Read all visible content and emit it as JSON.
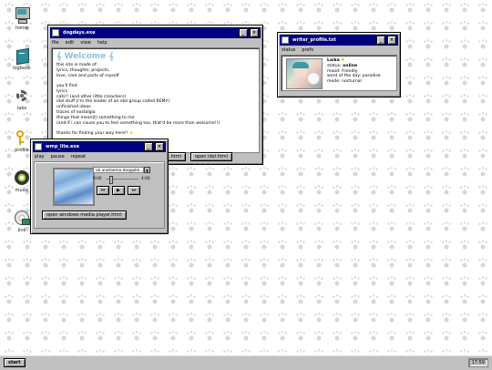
{
  "desktop_icons": [
    {
      "label": "home",
      "icon": "computer-icon"
    },
    {
      "label": "logbook",
      "icon": "notebook-icon"
    },
    {
      "label": "labs",
      "icon": "gear-icon"
    },
    {
      "label": "profile",
      "icon": "key-icon"
    },
    {
      "label": "music",
      "icon": "disc-icon"
    },
    {
      "label": "link",
      "icon": "cd-icon"
    }
  ],
  "dogdays": {
    "title": "dogdays.exe",
    "menu": [
      "file",
      "edit",
      "view",
      "help"
    ],
    "welcome": "Welcome",
    "lines": [
      "this site is made of:",
      "lyrics, thoughts, projects,",
      "love, care and parts of myself",
      "",
      "you'll find:",
      "lyrics",
      "cats!! (and other little creachers)",
      "idol stuff (i'm the leader of an idol group called REMI!)",
      "unfinished ideas",
      "traces of nostalgia",
      "things that mean(t) something to me",
      "(and if i can cause you to feel something too, that'd be more than welcome!!)",
      "",
      "thanks for finding your way here!!"
    ],
    "btn_left": ".html",
    "btn_right": "open idol.html"
  },
  "writer": {
    "title": "writer_profile.txt",
    "menu": [
      "status",
      "prefs"
    ],
    "name": "Laika",
    "status_label": "status:",
    "status_value": "online",
    "mood_label": "mood:",
    "mood_value": "friendly",
    "word_label": "word of the day:",
    "word_value": "paradise",
    "mode_label": "mode:",
    "mode_value": "nocturnal"
  },
  "wmp": {
    "title": "wmp_lite.exe",
    "menu": [
      "play",
      "pause",
      "repeat"
    ],
    "track": "ok:anataemo:doqqokk...",
    "time_start": "0:00",
    "time_end": "4:00",
    "progress": 0.12,
    "open_btn": "open windows media player.html"
  },
  "taskbar": {
    "start": "start",
    "clock": "17:59"
  }
}
